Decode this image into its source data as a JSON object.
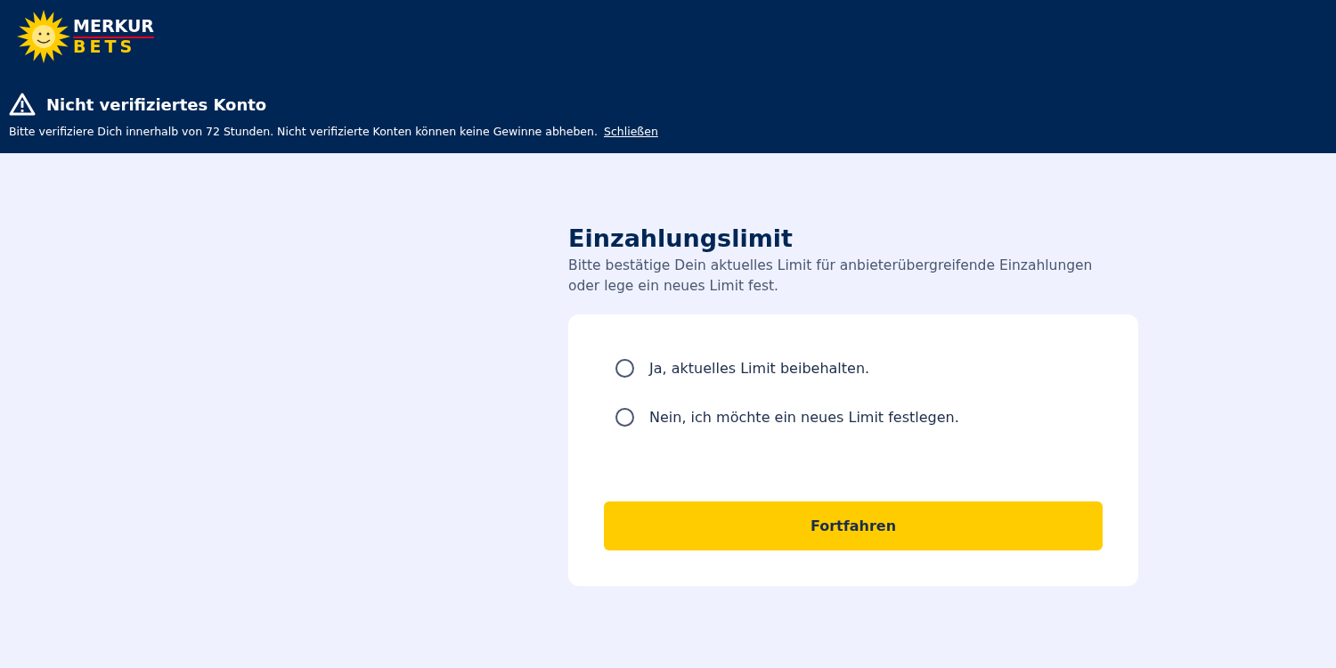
{
  "logo": {
    "line_1": "MERKUR",
    "line_2": "BETS"
  },
  "banner": {
    "title": "Nicht verifiziertes Konto",
    "message": "Bitte verifiziere Dich innerhalb von 72 Stunden. Nicht verifizierte Konten können keine Gewinne abheben.",
    "link": "Schließen"
  },
  "title": "Einzahlungslimit",
  "description": "Bitte bestätige Dein aktuelles Limit für anbieterübergreifende Einzahlungen oder lege ein neues Limit fest.",
  "options": [
    {
      "label": "Ja, aktuelles Limit beibehalten.",
      "selected": false
    },
    {
      "label": "Nein, ich möchte ein neues Limit festlegen.",
      "selected": false
    }
  ],
  "button": "Fortfahren"
}
